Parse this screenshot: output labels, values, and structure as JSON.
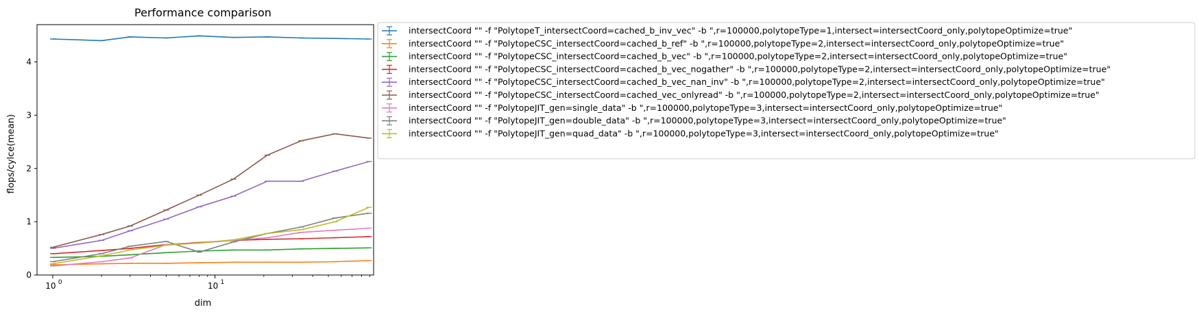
{
  "chart_data": {
    "type": "line",
    "title": "Performance comparison",
    "xlabel": "dim",
    "ylabel": "flops/cylce(mean)",
    "xscale": "log",
    "xlim": [
      0.8,
      95
    ],
    "ylim": [
      0,
      4.7
    ],
    "grid": false,
    "legend_position": "outside-right",
    "xticks": [
      {
        "value": 1,
        "base": "10",
        "exp": "0"
      },
      {
        "value": 10,
        "base": "10",
        "exp": "1"
      }
    ],
    "yticks": [
      0,
      1,
      2,
      3,
      4
    ],
    "x": [
      1,
      2,
      3,
      5,
      8,
      13,
      21,
      34,
      55,
      89
    ],
    "series": [
      {
        "name": "intersectCoord \"\" -f \"PolytopeT_intersectCoord=cached_b_inv_vec\" -b \",r=100000,polytopeType=1,intersect=intersectCoord_only,polytopeOptimize=true\"",
        "color": "#1f77b4",
        "values": [
          4.43,
          4.4,
          4.47,
          4.45,
          4.49,
          4.46,
          4.47,
          4.45,
          4.44,
          4.43
        ]
      },
      {
        "name": "intersectCoord \"\" -f \"PolytopeCSC_intersectCoord=cached_b_ref\" -b \",r=100000,polytopeType=2,intersect=intersectCoord_only,polytopeOptimize=true\"",
        "color": "#ff7f0e",
        "values": [
          0.19,
          0.21,
          0.22,
          0.22,
          0.23,
          0.24,
          0.24,
          0.24,
          0.25,
          0.27
        ]
      },
      {
        "name": "intersectCoord \"\" -f \"PolytopeCSC_intersectCoord=cached_b_vec\" -b \",r=100000,polytopeType=2,intersect=intersectCoord_only,polytopeOptimize=true\"",
        "color": "#2ca02c",
        "values": [
          0.33,
          0.35,
          0.38,
          0.42,
          0.45,
          0.47,
          0.47,
          0.49,
          0.5,
          0.51
        ]
      },
      {
        "name": "intersectCoord \"\" -f \"PolytopeCSC_intersectCoord=cached_b_vec_nogather\" -b \",r=100000,polytopeType=2,intersect=intersectCoord_only,polytopeOptimize=true\"",
        "color": "#d62728",
        "values": [
          0.4,
          0.46,
          0.5,
          0.57,
          0.61,
          0.65,
          0.67,
          0.68,
          0.7,
          0.72
        ]
      },
      {
        "name": "intersectCoord \"\" -f \"PolytopeCSC_intersectCoord=cached_b_vec_nan_inv\" -b \",r=100000,polytopeType=2,intersect=intersectCoord_only,polytopeOptimize=true\"",
        "color": "#9467bd",
        "values": [
          0.5,
          0.65,
          0.83,
          1.05,
          1.28,
          1.48,
          1.76,
          1.76,
          1.95,
          2.13
        ]
      },
      {
        "name": "intersectCoord \"\" -f \"PolytopeCSC_intersectCoord=cached_vec_onlyread\" -b \",r=100000,polytopeType=2,intersect=intersectCoord_only,polytopeOptimize=true\"",
        "color": "#8c564b",
        "values": [
          0.52,
          0.76,
          0.92,
          1.22,
          1.5,
          1.8,
          2.25,
          2.52,
          2.65,
          2.57
        ]
      },
      {
        "name": "intersectCoord \"\" -f \"PolytopeJIT_gen=single_data\" -b \",r=100000,polytopeType=3,intersect=intersectCoord_only,polytopeOptimize=true\"",
        "color": "#e377c2",
        "values": [
          0.17,
          0.25,
          0.32,
          0.57,
          0.6,
          0.65,
          0.7,
          0.8,
          0.84,
          0.88
        ]
      },
      {
        "name": "intersectCoord \"\" -f \"PolytopeJIT_gen=double_data\" -b \",r=100000,polytopeType=3,intersect=intersectCoord_only,polytopeOptimize=true\"",
        "color": "#7f7f7f",
        "values": [
          0.25,
          0.4,
          0.54,
          0.63,
          0.43,
          0.62,
          0.78,
          0.9,
          1.07,
          1.16
        ]
      },
      {
        "name": "intersectCoord \"\" -f \"PolytopeJIT_gen=quad_data\" -b \",r=100000,polytopeType=3,intersect=intersectCoord_only,polytopeOptimize=true\"",
        "color": "#bcbd22",
        "values": [
          0.21,
          0.36,
          0.47,
          0.56,
          0.6,
          0.66,
          0.78,
          0.85,
          1.0,
          1.27
        ]
      }
    ]
  }
}
